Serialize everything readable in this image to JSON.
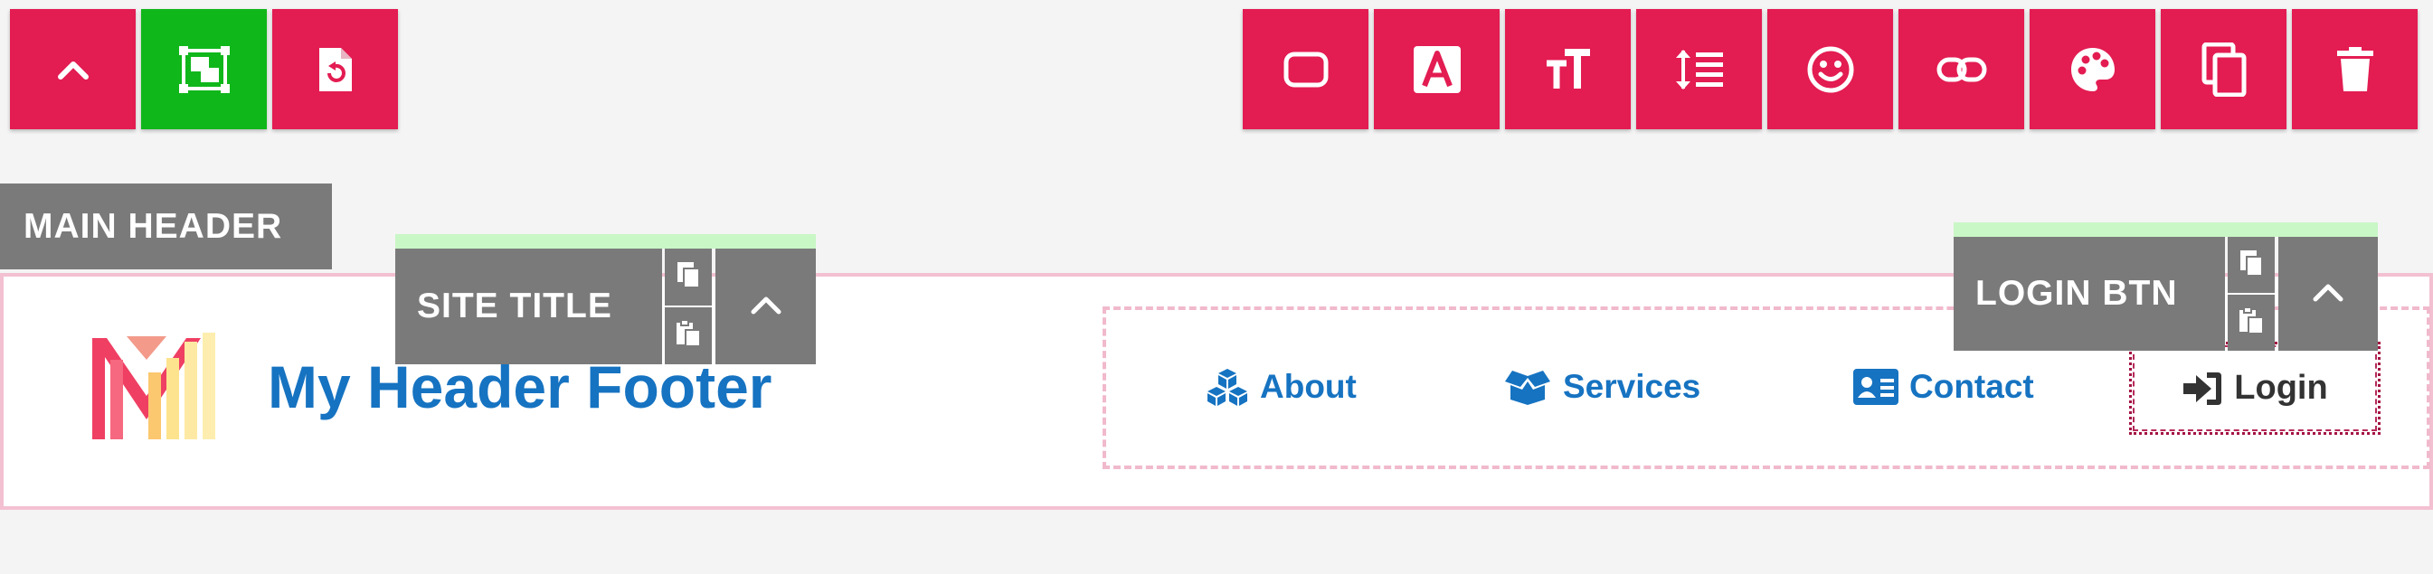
{
  "toolbar_left": [
    {
      "name": "collapse-up-button",
      "icon": "chevron-up-icon"
    },
    {
      "name": "select-element-button",
      "icon": "select-box-icon",
      "active": true
    },
    {
      "name": "reset-file-button",
      "icon": "file-reset-icon"
    }
  ],
  "toolbar_right": [
    {
      "name": "border-button",
      "icon": "rounded-rect-icon"
    },
    {
      "name": "font-button",
      "icon": "letter-a-icon"
    },
    {
      "name": "text-size-button",
      "icon": "text-size-icon"
    },
    {
      "name": "line-height-button",
      "icon": "line-height-icon"
    },
    {
      "name": "emoji-button",
      "icon": "smiley-icon"
    },
    {
      "name": "link-button",
      "icon": "link-icon"
    },
    {
      "name": "palette-button",
      "icon": "palette-icon"
    },
    {
      "name": "duplicate-button",
      "icon": "copy-icon"
    },
    {
      "name": "delete-button",
      "icon": "trash-icon"
    }
  ],
  "colors": {
    "toolbar_red": "#e31c52",
    "toolbar_green": "#10b71b",
    "tag_gray": "#7a7a7a",
    "link_blue": "#1673c1",
    "outline_pink": "#f3c0d2"
  },
  "tags": {
    "main_header": "MAIN HEADER",
    "site_title": "SITE TITLE",
    "login_btn": "LOGIN BTN"
  },
  "header": {
    "site_title": "My Header Footer"
  },
  "nav": {
    "about": "About",
    "services": "Services",
    "contact": "Contact",
    "login": "Login"
  }
}
